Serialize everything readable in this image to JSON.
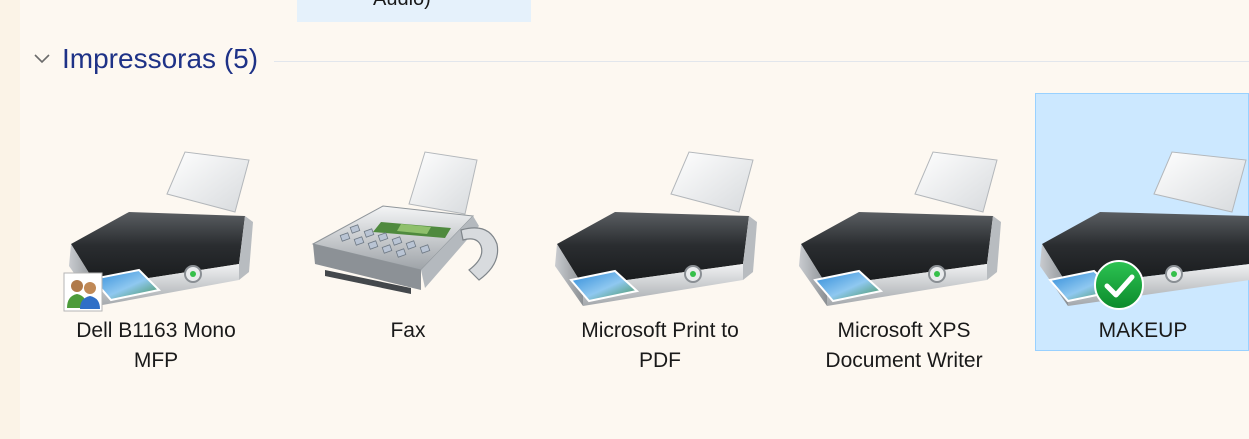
{
  "previous_item": {
    "label": "Áudio)"
  },
  "group": {
    "title": "Impressoras (5)",
    "expanded": true
  },
  "devices": [
    {
      "line1": "Dell B1163 Mono",
      "line2": "MFP",
      "icon": "printer-icon",
      "overlay": "shared-users-icon",
      "selected": false
    },
    {
      "line1": "Fax",
      "line2": "",
      "icon": "fax-icon",
      "overlay": "",
      "selected": false
    },
    {
      "line1": "Microsoft Print to",
      "line2": "PDF",
      "icon": "printer-icon",
      "overlay": "",
      "selected": false
    },
    {
      "line1": "Microsoft XPS",
      "line2": "Document Writer",
      "icon": "printer-icon",
      "overlay": "",
      "selected": false
    },
    {
      "line1": "MAKEUP",
      "line2": "",
      "icon": "printer-icon",
      "overlay": "default-check-icon",
      "selected": true
    }
  ],
  "colors": {
    "group_title": "#1e3287",
    "selection_fill": "#cce8ff",
    "selection_border": "#99d1ff",
    "check_green": "#13a538"
  }
}
